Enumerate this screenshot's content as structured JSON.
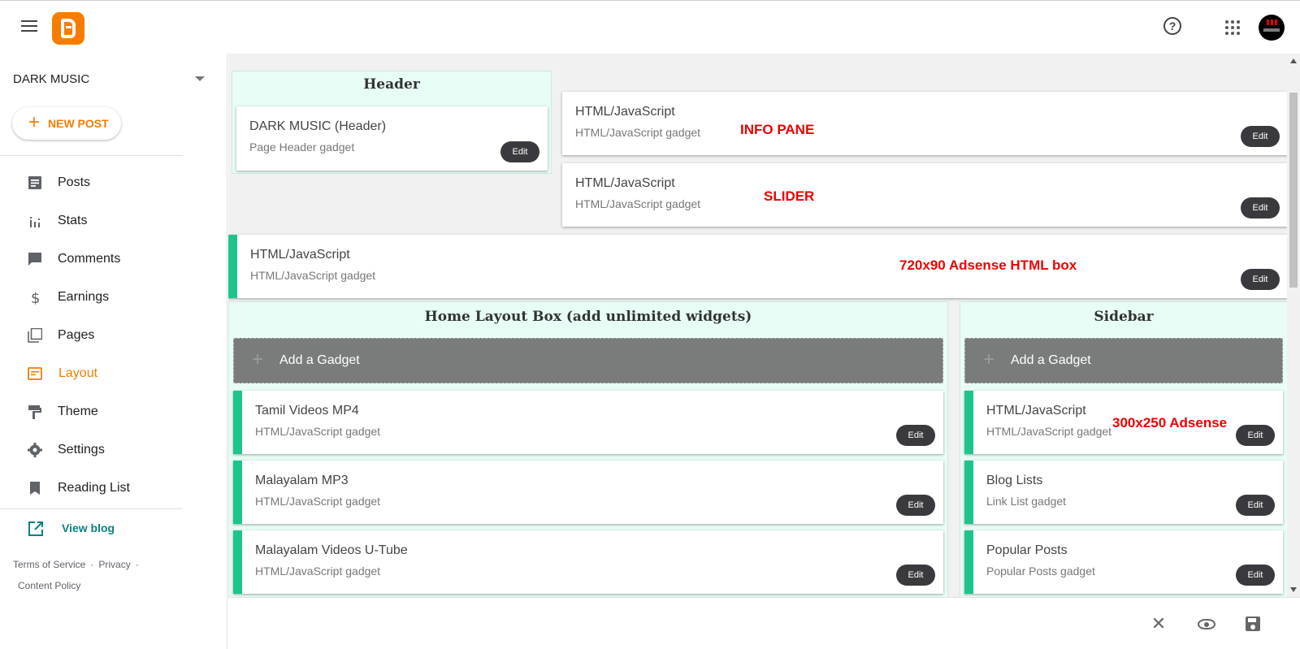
{
  "sidebar": {
    "blog_name": "DARK MUSIC",
    "new_post_label": "NEW POST",
    "nav": [
      {
        "label": "Posts",
        "icon": "posts-icon"
      },
      {
        "label": "Stats",
        "icon": "stats-icon"
      },
      {
        "label": "Comments",
        "icon": "comments-icon"
      },
      {
        "label": "Earnings",
        "icon": "earnings-icon"
      },
      {
        "label": "Pages",
        "icon": "pages-icon"
      },
      {
        "label": "Layout",
        "icon": "layout-icon",
        "active": true
      },
      {
        "label": "Theme",
        "icon": "theme-icon"
      },
      {
        "label": "Settings",
        "icon": "settings-icon"
      },
      {
        "label": "Reading List",
        "icon": "reading-list-icon"
      }
    ],
    "view_blog_label": "View blog",
    "footer": {
      "terms": "Terms of Service",
      "privacy": "Privacy",
      "content_policy": "Content Policy"
    }
  },
  "layout": {
    "header_section": {
      "title": "Header",
      "gadget": {
        "title": "DARK MUSIC (Header)",
        "subtitle": "Page Header gadget",
        "edit": "Edit"
      }
    },
    "top_gadgets": [
      {
        "title": "HTML/JavaScript",
        "subtitle": "HTML/JavaScript gadget",
        "annotation": "INFO PANE",
        "edit": "Edit"
      },
      {
        "title": "HTML/JavaScript",
        "subtitle": "HTML/JavaScript gadget",
        "annotation": "SLIDER",
        "edit": "Edit"
      }
    ],
    "wide_gadget": {
      "title": "HTML/JavaScript",
      "subtitle": "HTML/JavaScript gadget",
      "annotation": "720x90  Adsense HTML box",
      "edit": "Edit"
    },
    "home_section": {
      "title": "Home Layout Box (add unlimited widgets)",
      "add_gadget": "Add a Gadget",
      "gadgets": [
        {
          "title": "Tamil Videos MP4",
          "subtitle": "HTML/JavaScript gadget",
          "edit": "Edit"
        },
        {
          "title": "Malayalam MP3",
          "subtitle": "HTML/JavaScript gadget",
          "edit": "Edit"
        },
        {
          "title": "Malayalam Videos U-Tube",
          "subtitle": "HTML/JavaScript gadget",
          "edit": "Edit"
        }
      ]
    },
    "sidebar_section": {
      "title": "Sidebar",
      "add_gadget": "Add a Gadget",
      "gadgets": [
        {
          "title": "HTML/JavaScript",
          "subtitle": "HTML/JavaScript gadget",
          "annotation": "300x250  Adsense",
          "edit": "Edit"
        },
        {
          "title": "Blog Lists",
          "subtitle": "Link List gadget",
          "edit": "Edit"
        },
        {
          "title": "Popular Posts",
          "subtitle": "Popular Posts gadget",
          "edit": "Edit"
        }
      ]
    }
  },
  "colors": {
    "brand": "#f57d00",
    "accent_stripe": "#1ec58a",
    "annotation": "#e00000",
    "view_blog": "#0b8080"
  }
}
